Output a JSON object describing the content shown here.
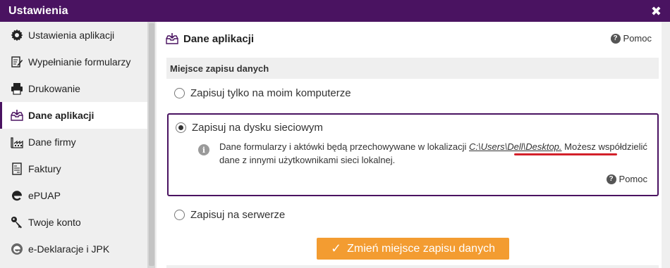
{
  "window": {
    "title": "Ustawienia",
    "close_icon": "close-icon"
  },
  "sidebar": {
    "items": [
      {
        "label": "Ustawienia aplikacji",
        "icon": "gear-icon",
        "active": false
      },
      {
        "label": "Wypełnianie formularzy",
        "icon": "form-edit-icon",
        "active": false
      },
      {
        "label": "Drukowanie",
        "icon": "printer-icon",
        "active": false
      },
      {
        "label": "Dane aplikacji",
        "icon": "inbox-download-icon",
        "active": true
      },
      {
        "label": "Dane firmy",
        "icon": "factory-icon",
        "active": false
      },
      {
        "label": "Faktury",
        "icon": "invoice-icon",
        "active": false
      },
      {
        "label": "ePUAP",
        "icon": "epuap-icon",
        "active": false
      },
      {
        "label": "Twoje konto",
        "icon": "key-icon",
        "active": false
      },
      {
        "label": "e-Deklaracje i JPK",
        "icon": "edeklaracje-icon",
        "active": false
      }
    ]
  },
  "panel": {
    "title": "Dane aplikacji",
    "help_label": "Pomoc",
    "section_title": "Miejsce zapisu danych",
    "options": {
      "local": "Zapisuj tylko na moim komputerze",
      "network": "Zapisuj na dysku sieciowym",
      "server": "Zapisuj na serwerze"
    },
    "selected": "network",
    "info": {
      "text_before": "Dane formularzy i aktówki będą przechowywane w lokalizacji ",
      "path": "C:\\Users\\Dell\\Desktop.",
      "text_after": " Możesz współdzielić dane z innymi użytkownikami sieci lokalnej."
    },
    "inner_help_label": "Pomoc",
    "button_label": "Zmień miejsce zapisu danych"
  },
  "colors": {
    "accent": "#4a1361",
    "button": "#f39c31",
    "annotation": "#d3202a"
  }
}
